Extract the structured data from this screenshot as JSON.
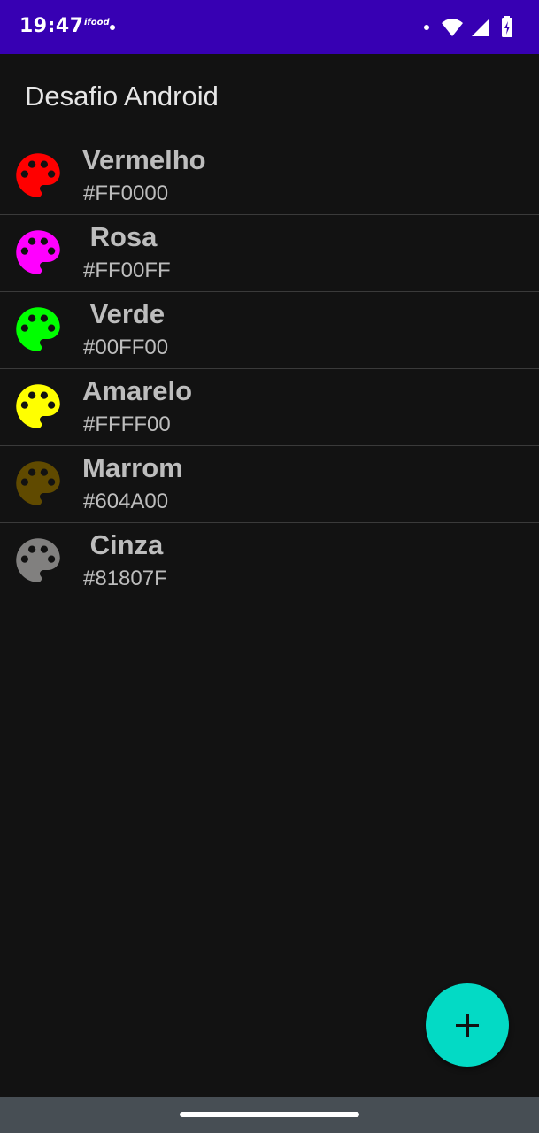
{
  "status_bar": {
    "time": "19:47",
    "app_icon_text": "ifood",
    "background": "#3700b3",
    "icons": [
      "notification-dot-icon",
      "wifi-icon",
      "signal-icon",
      "battery-charging-icon"
    ]
  },
  "app_bar": {
    "title": "Desafio Android"
  },
  "colors": [
    {
      "name": "Vermelho",
      "hex": "#FF0000",
      "swatch": "#FF0000",
      "icon": "palette-icon"
    },
    {
      "name": " Rosa",
      "hex": "#FF00FF",
      "swatch": "#FF00FF",
      "icon": "palette-icon"
    },
    {
      "name": " Verde",
      "hex": "#00FF00",
      "swatch": "#00FF00",
      "icon": "palette-icon"
    },
    {
      "name": "Amarelo",
      "hex": "#FFFF00",
      "swatch": "#FFFF00",
      "icon": "palette-icon"
    },
    {
      "name": "Marrom",
      "hex": "#604A00",
      "swatch": "#604A00",
      "icon": "palette-icon"
    },
    {
      "name": " Cinza",
      "hex": "#81807F",
      "swatch": "#81807F",
      "icon": "palette-icon"
    }
  ],
  "fab": {
    "icon": "add-icon",
    "color": "#03DAC5"
  },
  "theme": {
    "background": "#121212",
    "nav_bar": "#474E54"
  }
}
